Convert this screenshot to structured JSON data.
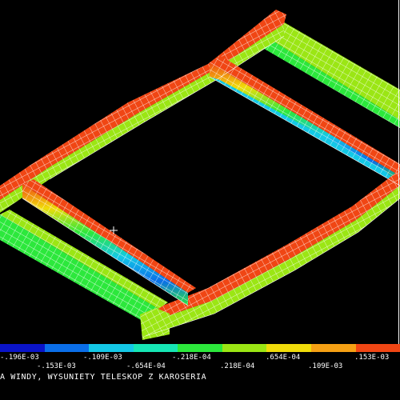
{
  "legend": {
    "colors": [
      "#0a14c8",
      "#0a6ee8",
      "#14c8e6",
      "#16e6b4",
      "#2ce83c",
      "#9be614",
      "#f0dc0a",
      "#f5a014",
      "#f04614"
    ],
    "labels_top": [
      "-.196E-03",
      "-.109E-03",
      "-.218E-04",
      ".654E-04",
      ".153E-03"
    ],
    "labels_bottom": [
      "-.153E-03",
      "-.654E-04",
      ".218E-04",
      ".109E-03"
    ]
  },
  "caption": "A WINDY, WYSUNIETY TELESKOP Z KAROSERIA",
  "cursor_icon": "cross-cursor-icon"
}
